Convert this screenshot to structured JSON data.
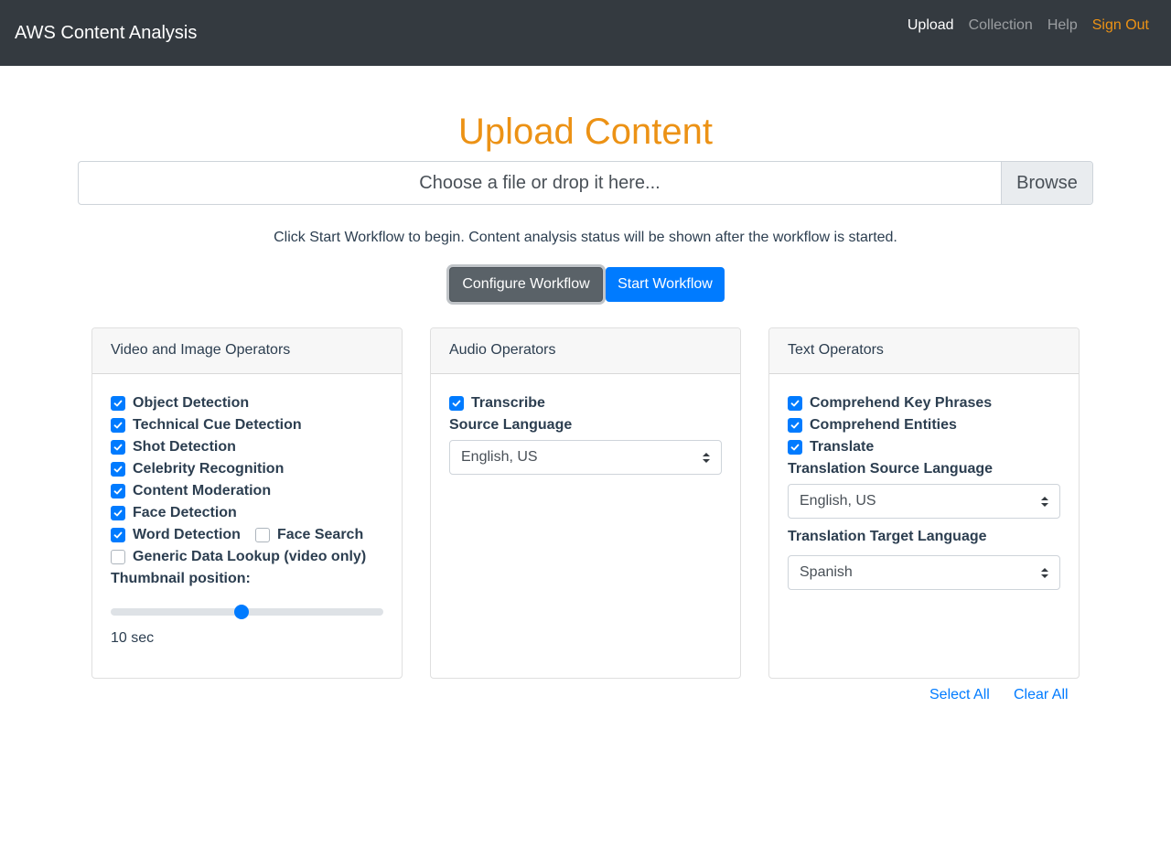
{
  "navbar": {
    "brand": "AWS Content Analysis",
    "links": [
      {
        "label": "Upload"
      },
      {
        "label": "Collection"
      },
      {
        "label": "Help"
      },
      {
        "label": "Sign Out"
      }
    ]
  },
  "upload": {
    "title": "Upload Content",
    "file_placeholder": "Choose a file or drop it here...",
    "browse_label": "Browse",
    "hint": "Click Start Workflow to begin. Content analysis status will be shown after the workflow is started.",
    "configure_label": "Configure Workflow",
    "start_label": "Start Workflow"
  },
  "video_card": {
    "title": "Video and Image Operators",
    "options": [
      {
        "label": "Object Detection",
        "checked": true
      },
      {
        "label": "Technical Cue Detection",
        "checked": true
      },
      {
        "label": "Shot Detection",
        "checked": true
      },
      {
        "label": "Celebrity Recognition",
        "checked": true
      },
      {
        "label": "Content Moderation",
        "checked": true
      },
      {
        "label": "Face Detection",
        "checked": true
      },
      {
        "label": "Word Detection",
        "checked": true
      },
      {
        "label": "Face Search",
        "checked": false
      },
      {
        "label": "Generic Data Lookup (video only)",
        "checked": false
      }
    ],
    "thumbnail_label": "Thumbnail position:",
    "thumbnail_fraction": 0.48,
    "thumbnail_value": "10 sec"
  },
  "audio_card": {
    "title": "Audio Operators",
    "options": [
      {
        "label": "Transcribe",
        "checked": true
      }
    ],
    "source_language_label": "Source Language",
    "source_language": "English, US"
  },
  "text_card": {
    "title": "Text Operators",
    "options": [
      {
        "label": "Comprehend Key Phrases",
        "checked": true
      },
      {
        "label": "Comprehend Entities",
        "checked": true
      },
      {
        "label": "Translate",
        "checked": true
      }
    ],
    "source_language_label": "Translation Source Language",
    "source_language": "English, US",
    "target_language_label": "Translation Target Language",
    "target_language": "Spanish"
  },
  "actions": {
    "select_all": "Select All",
    "clear_all": "Clear All"
  },
  "colors": {
    "accent": "#ec9215",
    "primary": "#007bff",
    "navbar": "#343a40"
  },
  "icons": {
    "checkbox_check": "check-icon",
    "select_caret": "sort-caret-icon"
  }
}
